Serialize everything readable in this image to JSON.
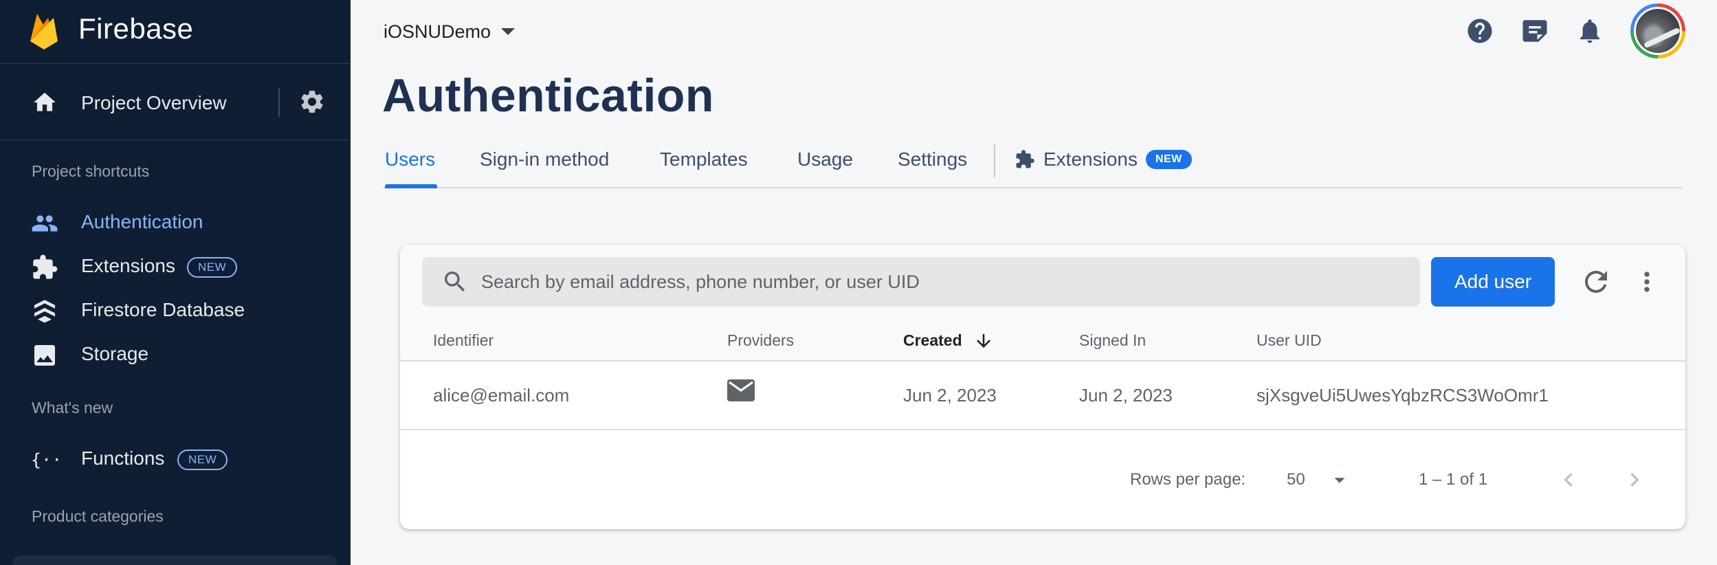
{
  "sidebar": {
    "brand": "Firebase",
    "overview_label": "Project Overview",
    "sections": {
      "shortcuts": "Project shortcuts",
      "whats_new": "What's new",
      "categories": "Product categories"
    },
    "shortcuts": [
      {
        "label": "Authentication",
        "icon": "people-icon",
        "active": true
      },
      {
        "label": "Extensions",
        "icon": "extensions-icon",
        "badge": "NEW"
      },
      {
        "label": "Firestore Database",
        "icon": "firestore-icon"
      },
      {
        "label": "Storage",
        "icon": "image-icon"
      }
    ],
    "whats_new": [
      {
        "label": "Functions",
        "icon": "functions-icon",
        "badge": "NEW"
      }
    ]
  },
  "header": {
    "project_name": "iOSNUDemo",
    "page_title": "Authentication",
    "icons": [
      "help-icon",
      "feedback-icon",
      "notifications-icon",
      "avatar"
    ]
  },
  "tabs": [
    {
      "label": "Users",
      "active": true
    },
    {
      "label": "Sign-in method"
    },
    {
      "label": "Templates"
    },
    {
      "label": "Usage"
    },
    {
      "label": "Settings"
    },
    {
      "label": "Extensions",
      "badge": "NEW"
    }
  ],
  "users_panel": {
    "search_placeholder": "Search by email address, phone number, or user UID",
    "add_user_label": "Add user",
    "columns": [
      "Identifier",
      "Providers",
      "Created",
      "Signed In",
      "User UID"
    ],
    "sorted_column": "Created",
    "rows": [
      {
        "identifier": "alice@email.com",
        "provider_icon": "mail-icon",
        "created": "Jun 2, 2023",
        "signed_in": "Jun 2, 2023",
        "uid": "sjXsgveUi5UwesYqbzRCS3WoOmr1"
      }
    ],
    "pagination": {
      "rows_per_page_label": "Rows per page:",
      "rows_per_page": "50",
      "range": "1 – 1 of 1"
    }
  },
  "colors": {
    "sidebar_bg": "#0f1e33",
    "accent": "#1a73e8",
    "active_nav": "#8ab4f8",
    "title": "#1f3150"
  }
}
